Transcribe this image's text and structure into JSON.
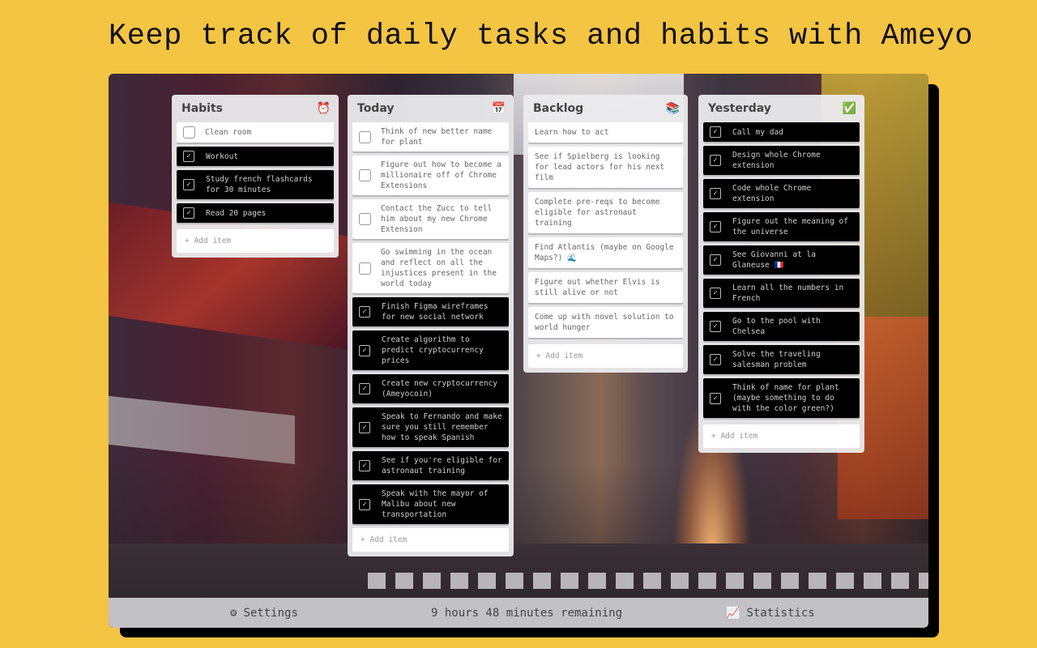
{
  "headline": "Keep track of daily tasks and habits with Ameyo",
  "colors": {
    "page_background": "#f4c443",
    "card_done": "#000000",
    "card_todo": "#ffffff",
    "column_background": "#ececee"
  },
  "columns": {
    "habits": {
      "title": "Habits",
      "icon": "alarm-clock-icon",
      "icon_glyph": "⏰",
      "items": [
        {
          "text": "Clean room",
          "done": false
        },
        {
          "text": "Workout",
          "done": true
        },
        {
          "text": "Study french flashcards for 30 minutes",
          "done": true
        },
        {
          "text": "Read 20 pages",
          "done": true
        }
      ],
      "add_label": "+ Add item"
    },
    "today": {
      "title": "Today",
      "icon": "calendar-icon",
      "icon_glyph": "📅",
      "items": [
        {
          "text": "Think of new better name for plant",
          "done": false
        },
        {
          "text": "Figure out how to become a millionaire off of Chrome Extensions",
          "done": false
        },
        {
          "text": "Contact the Zucc to tell him about my new Chrome Extension",
          "done": false
        },
        {
          "text": "Go swimming in the ocean and reflect on all the injustices present in the world today",
          "done": false
        },
        {
          "text": "Finish Figma wireframes for new social network",
          "done": true
        },
        {
          "text": "Create algorithm to predict cryptocurrency prices",
          "done": true
        },
        {
          "text": "Create new cryptocurrency (Ameyocoin)",
          "done": true
        },
        {
          "text": "Speak to Fernando and make sure you still remember how to speak Spanish",
          "done": true
        },
        {
          "text": "See if you're eligible for astronaut training",
          "done": true
        },
        {
          "text": "Speak with the mayor of Malibu about new transportation",
          "done": true
        }
      ],
      "add_label": "+ Add item"
    },
    "backlog": {
      "title": "Backlog",
      "icon": "books-icon",
      "icon_glyph": "📚",
      "items": [
        {
          "text": "Learn how to act"
        },
        {
          "text": "See if Spielberg is looking for lead actors for his next film"
        },
        {
          "text": "Complete pre-reqs to become eligible for astronaut training"
        },
        {
          "text": "Find Atlantis (maybe on Google Maps?) 🌊"
        },
        {
          "text": "Figure out whether Elvis is still alive or not"
        },
        {
          "text": "Come up with novel solution to world hunger"
        }
      ],
      "add_label": "+ Add item"
    },
    "yesterday": {
      "title": "Yesterday",
      "icon": "check-mark-icon",
      "icon_glyph": "✅",
      "items": [
        {
          "text": "Call my dad",
          "done": true
        },
        {
          "text": "Design whole Chrome extension",
          "done": true
        },
        {
          "text": "Code whole Chrome extension",
          "done": true
        },
        {
          "text": "Figure out the meaning of the universe",
          "done": true
        },
        {
          "text": "See Giovanni at la Glaneuse 🇫🇷",
          "done": true
        },
        {
          "text": "Learn all the numbers in French",
          "done": true
        },
        {
          "text": "Go to the pool with Chelsea",
          "done": true
        },
        {
          "text": "Solve the traveling salesman problem",
          "done": true
        },
        {
          "text": "Think of name for plant (maybe something to do with the color green?)",
          "done": true
        }
      ],
      "add_label": "+ Add item"
    }
  },
  "bottom_bar": {
    "settings_label": "Settings",
    "settings_icon": "⚙",
    "time_remaining": "9 hours 48 minutes remaining",
    "statistics_label": "Statistics",
    "statistics_icon": "📈"
  }
}
